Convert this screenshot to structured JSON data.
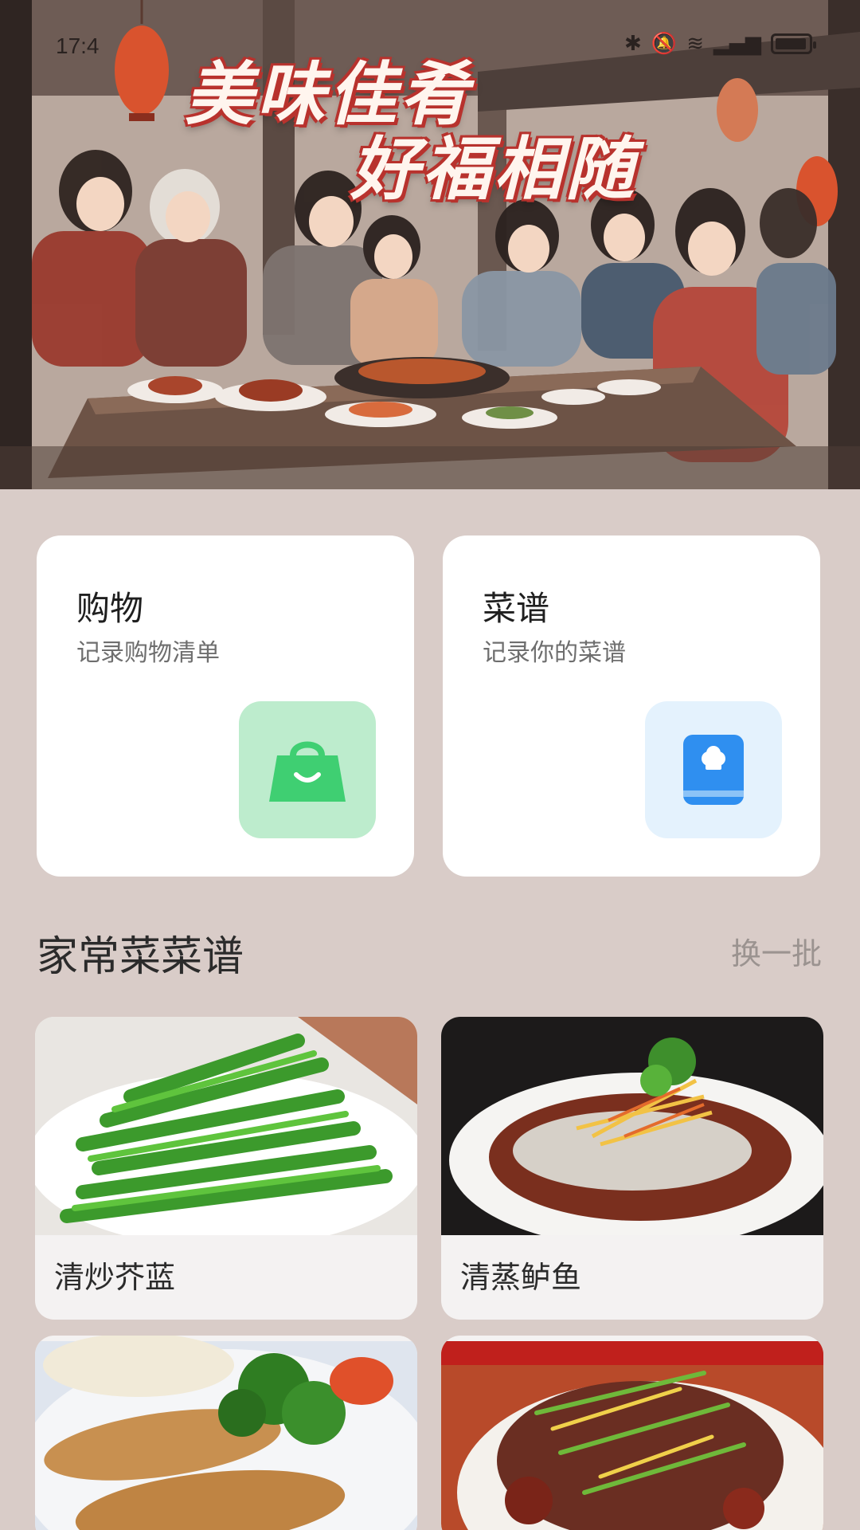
{
  "status_bar": {
    "time": "17:4",
    "icons": [
      "bluetooth-icon",
      "mute-icon",
      "wifi-icon",
      "signal-icon",
      "battery-icon"
    ]
  },
  "hero": {
    "title_line1": "美味佳肴",
    "title_line2": "好福相随"
  },
  "cards": {
    "shopping": {
      "title": "购物",
      "subtitle": "记录购物清单",
      "icon": "shopping-bag-icon",
      "accent": "#3fcf72"
    },
    "recipe": {
      "title": "菜谱",
      "subtitle": "记录你的菜谱",
      "icon": "recipe-book-icon",
      "accent": "#2f8ff0"
    }
  },
  "section": {
    "title": "家常菜菜谱",
    "refresh_label": "换一批"
  },
  "dishes": [
    {
      "name": "清炒芥蓝"
    },
    {
      "name": "清蒸鲈鱼"
    },
    {
      "name": ""
    },
    {
      "name": ""
    }
  ],
  "colors": {
    "page_background": "#d9ccc8",
    "card_background": "#ffffff",
    "title_red": "#b8322d"
  }
}
